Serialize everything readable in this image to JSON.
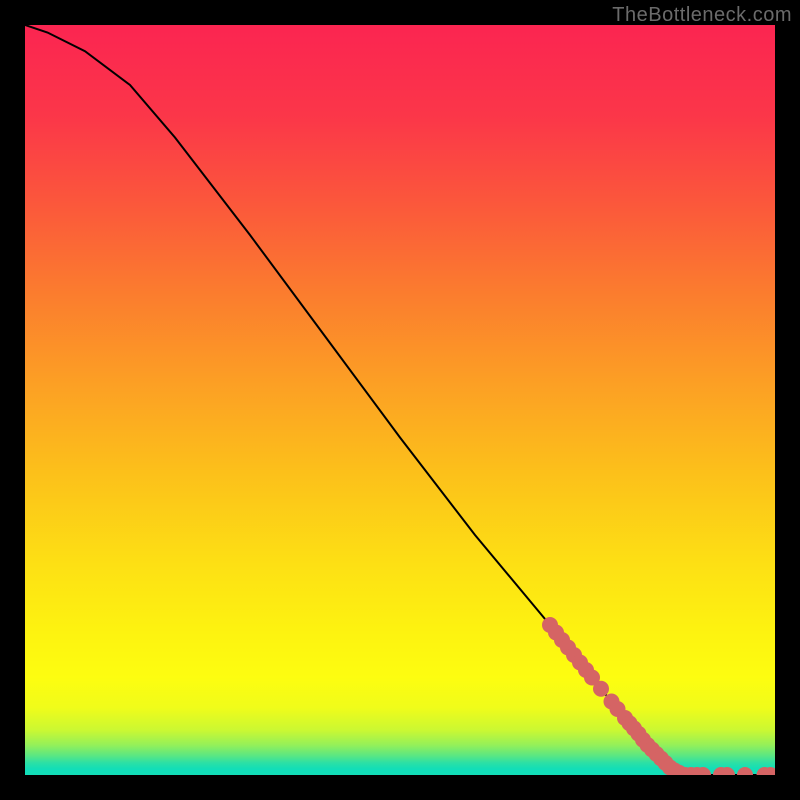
{
  "watermark": "TheBottleneck.com",
  "chart_data": {
    "type": "line",
    "title": "",
    "xlabel": "",
    "ylabel": "",
    "xlim": [
      0,
      100
    ],
    "ylim": [
      0,
      100
    ],
    "curve": [
      {
        "x": 0,
        "y": 100
      },
      {
        "x": 3,
        "y": 99
      },
      {
        "x": 8,
        "y": 96.5
      },
      {
        "x": 14,
        "y": 92
      },
      {
        "x": 20,
        "y": 85
      },
      {
        "x": 30,
        "y": 72
      },
      {
        "x": 40,
        "y": 58.5
      },
      {
        "x": 50,
        "y": 45
      },
      {
        "x": 60,
        "y": 32
      },
      {
        "x": 70,
        "y": 20
      },
      {
        "x": 78,
        "y": 10
      },
      {
        "x": 83,
        "y": 4
      },
      {
        "x": 86,
        "y": 1
      },
      {
        "x": 88,
        "y": 0
      },
      {
        "x": 100,
        "y": 0
      }
    ],
    "markers": [
      {
        "x": 70.0,
        "y": 20.0
      },
      {
        "x": 70.8,
        "y": 19.0
      },
      {
        "x": 71.6,
        "y": 18.0
      },
      {
        "x": 72.4,
        "y": 17.0
      },
      {
        "x": 73.2,
        "y": 16.0
      },
      {
        "x": 74.0,
        "y": 15.0
      },
      {
        "x": 74.8,
        "y": 14.0
      },
      {
        "x": 75.6,
        "y": 13.0
      },
      {
        "x": 76.8,
        "y": 11.5
      },
      {
        "x": 78.2,
        "y": 9.8
      },
      {
        "x": 79.0,
        "y": 8.8
      },
      {
        "x": 80.0,
        "y": 7.6
      },
      {
        "x": 80.6,
        "y": 6.9
      },
      {
        "x": 81.2,
        "y": 6.2
      },
      {
        "x": 81.8,
        "y": 5.5
      },
      {
        "x": 82.4,
        "y": 4.7
      },
      {
        "x": 83.0,
        "y": 4.0
      },
      {
        "x": 83.6,
        "y": 3.4
      },
      {
        "x": 84.2,
        "y": 2.8
      },
      {
        "x": 84.8,
        "y": 2.2
      },
      {
        "x": 85.4,
        "y": 1.6
      },
      {
        "x": 86.0,
        "y": 1.0
      },
      {
        "x": 86.6,
        "y": 0.6
      },
      {
        "x": 87.2,
        "y": 0.3
      },
      {
        "x": 88.0,
        "y": 0.0
      },
      {
        "x": 88.8,
        "y": 0.0
      },
      {
        "x": 89.6,
        "y": 0.0
      },
      {
        "x": 90.4,
        "y": 0.0
      },
      {
        "x": 92.8,
        "y": 0.0
      },
      {
        "x": 93.6,
        "y": 0.0
      },
      {
        "x": 96.0,
        "y": 0.0
      },
      {
        "x": 98.6,
        "y": 0.0
      },
      {
        "x": 99.4,
        "y": 0.0
      }
    ],
    "gradient_stops": [
      {
        "offset": 0.0,
        "color": "#fb2551"
      },
      {
        "offset": 0.12,
        "color": "#fb3649"
      },
      {
        "offset": 0.24,
        "color": "#fb583b"
      },
      {
        "offset": 0.36,
        "color": "#fb7d2e"
      },
      {
        "offset": 0.48,
        "color": "#fca024"
      },
      {
        "offset": 0.6,
        "color": "#fcc11a"
      },
      {
        "offset": 0.72,
        "color": "#fde014"
      },
      {
        "offset": 0.81,
        "color": "#fdf310"
      },
      {
        "offset": 0.87,
        "color": "#fdfd10"
      },
      {
        "offset": 0.91,
        "color": "#f0fc1a"
      },
      {
        "offset": 0.94,
        "color": "#cbf832"
      },
      {
        "offset": 0.96,
        "color": "#94f059"
      },
      {
        "offset": 0.974,
        "color": "#5be782"
      },
      {
        "offset": 0.984,
        "color": "#2be0a6"
      },
      {
        "offset": 0.992,
        "color": "#12deb8"
      },
      {
        "offset": 1.0,
        "color": "#12deb8"
      }
    ],
    "marker_color": "#d56464",
    "line_color": "#000000"
  }
}
